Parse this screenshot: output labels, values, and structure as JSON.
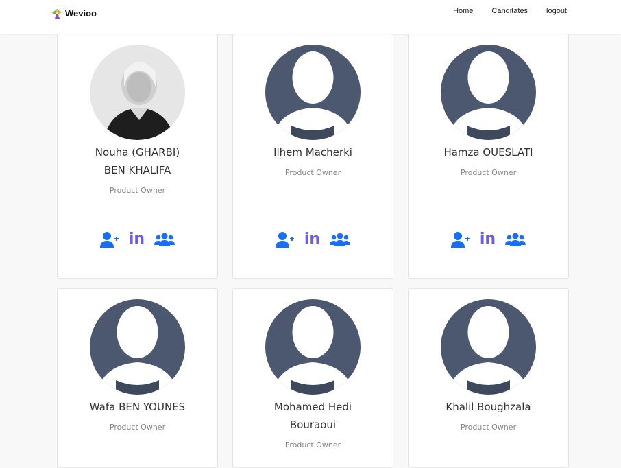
{
  "brand": {
    "name": "Wevioo"
  },
  "nav": {
    "home": "Home",
    "candidates": "Canditates",
    "logout": "logout"
  },
  "cards": [
    {
      "name_line1": "Nouha (GHARBI)",
      "name_line2": "BEN KHALIFA",
      "role": "Product Owner",
      "avatar": "photo"
    },
    {
      "name_line1": "Ilhem Macherki",
      "name_line2": "",
      "role": "Product Owner",
      "avatar": "placeholder"
    },
    {
      "name_line1": "Hamza OUESLATI",
      "name_line2": "",
      "role": "Product Owner",
      "avatar": "placeholder"
    },
    {
      "name_line1": "Wafa BEN YOUNES",
      "name_line2": "",
      "role": "Product Owner",
      "avatar": "placeholder"
    },
    {
      "name_line1": "Mohamed Hedi",
      "name_line2": "Bouraoui",
      "role": "Product Owner",
      "avatar": "placeholder"
    },
    {
      "name_line1": "Khalil Boughzala",
      "name_line2": "",
      "role": "Product Owner",
      "avatar": "placeholder"
    }
  ],
  "actions": {
    "linkedin_label": "in"
  },
  "icons": {
    "add_user": "user-plus-icon",
    "linkedin": "linkedin-icon",
    "team": "users-icon"
  },
  "colors": {
    "accent": "#1a6ef5",
    "linkedin": "#6f5af0",
    "avatar_bg": "#4b5870"
  }
}
